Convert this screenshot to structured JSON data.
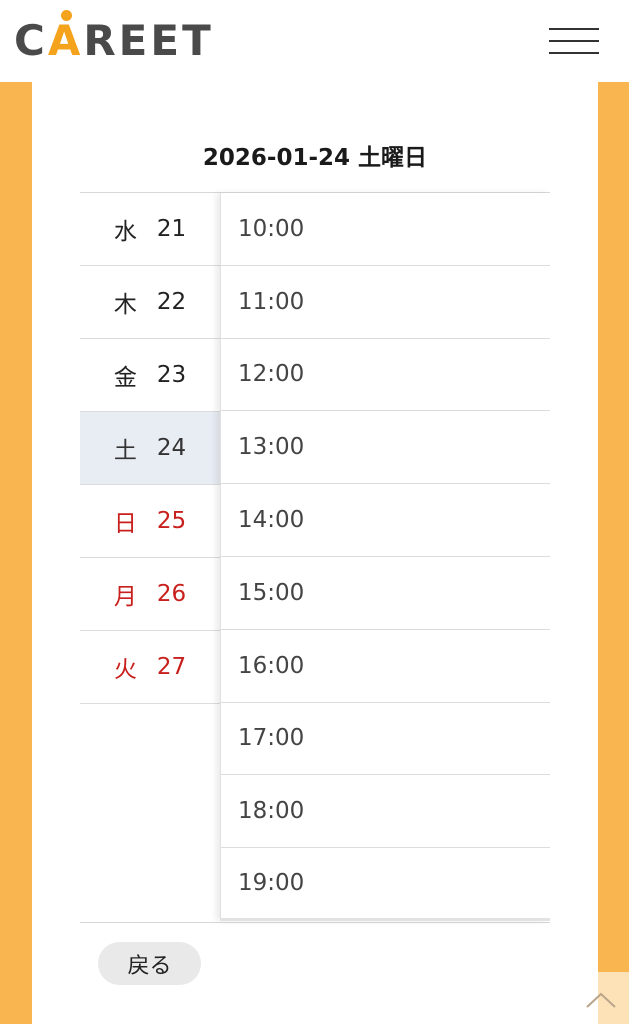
{
  "header": {
    "logo_prefix": "C",
    "logo_a": "A",
    "logo_suffix": "REET"
  },
  "date_title": "2026-01-24 土曜日",
  "days": [
    {
      "dow": "水",
      "num": "21",
      "red": false,
      "selected": false
    },
    {
      "dow": "木",
      "num": "22",
      "red": false,
      "selected": false
    },
    {
      "dow": "金",
      "num": "23",
      "red": false,
      "selected": false
    },
    {
      "dow": "土",
      "num": "24",
      "red": false,
      "selected": true
    },
    {
      "dow": "日",
      "num": "25",
      "red": true,
      "selected": false
    },
    {
      "dow": "月",
      "num": "26",
      "red": true,
      "selected": false
    },
    {
      "dow": "火",
      "num": "27",
      "red": true,
      "selected": false
    }
  ],
  "times": [
    "10:00",
    "11:00",
    "12:00",
    "13:00",
    "14:00",
    "15:00",
    "16:00",
    "17:00",
    "18:00",
    "19:00"
  ],
  "back_label": "戻る",
  "colors": {
    "accent": "#f9b550",
    "logo_accent": "#f5a21c",
    "holiday_red": "#c8201c",
    "selected_bg": "#e8ecf3"
  }
}
